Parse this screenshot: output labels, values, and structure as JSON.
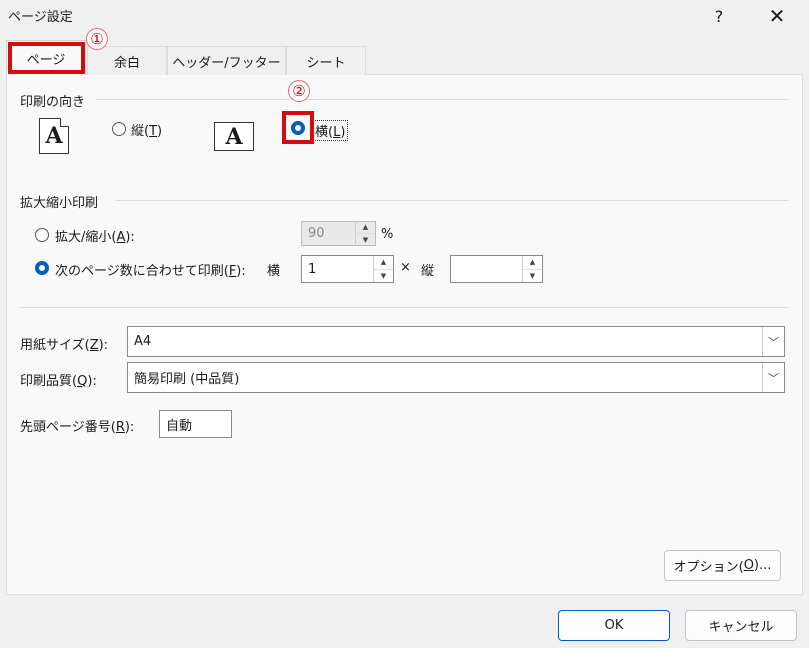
{
  "window": {
    "title": "ページ設定",
    "help": "?",
    "close": "✕"
  },
  "tabs": [
    {
      "label": "ページ"
    },
    {
      "label": "余白"
    },
    {
      "label": "ヘッダー/フッター"
    },
    {
      "label": "シート"
    }
  ],
  "annotations": {
    "one": "①",
    "two": "②"
  },
  "orientation": {
    "group_label": "印刷の向き",
    "icon_letter": "A",
    "portrait_label_pre": "縦(",
    "portrait_key": "T",
    "portrait_label_post": ")",
    "landscape_label_pre": "横(",
    "landscape_key": "L",
    "landscape_label_post": ")",
    "selected": "landscape"
  },
  "scaling": {
    "group_label": "拡大縮小印刷",
    "zoom_label_pre": "拡大/縮小(",
    "zoom_key": "A",
    "zoom_label_post": "):",
    "zoom_value": "90",
    "zoom_unit": "%",
    "fit_label_pre": "次のページ数に合わせて印刷(",
    "fit_key": "F",
    "fit_label_post": "):",
    "wide_label": "横",
    "wide_value": "1",
    "times": "×",
    "tall_label": "縦",
    "tall_value": ""
  },
  "paper": {
    "size_label_pre": "用紙サイズ(",
    "size_key": "Z",
    "size_label_post": "):",
    "size_value": "A4",
    "quality_label_pre": "印刷品質(",
    "quality_key": "Q",
    "quality_label_post": "):",
    "quality_value": "簡易印刷 (中品質)",
    "first_page_label_pre": "先頭ページ番号(",
    "first_page_key": "R",
    "first_page_label_post": "):",
    "first_page_value": "自動"
  },
  "buttons": {
    "options_pre": "オプション(",
    "options_key": "O",
    "options_post": ")...",
    "ok": "OK",
    "cancel": "キャンセル"
  },
  "colors": {
    "accent": "#005fb8",
    "annotation": "#d10d0d"
  }
}
